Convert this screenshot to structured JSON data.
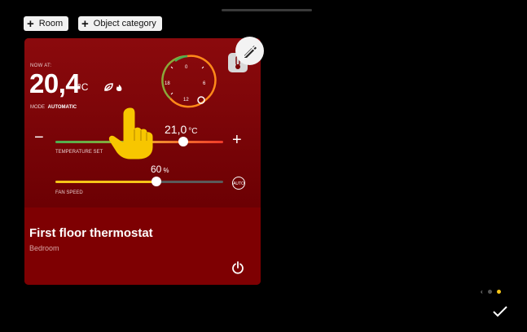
{
  "toolbar": {
    "room_label": "Room",
    "category_label": "Object category"
  },
  "card": {
    "now_at_label": "NOW AT:",
    "current_temp": "20,4",
    "temp_unit": "°C",
    "mode_label": "MODE",
    "mode_value": "AUTOMATIC",
    "dial_ticks": [
      "0",
      "6",
      "12",
      "18"
    ],
    "setpoint_value": "21,0",
    "setpoint_unit": "°C",
    "setpoint_level": 0.76,
    "temperature_setpoint_label": "TEMPERATURE SET",
    "fan_value": "60",
    "fan_unit": "%",
    "fan_level": 0.6,
    "fan_speed_label": "FAN SPEED",
    "auto_label": "AUTO",
    "title": "First floor thermostat",
    "subtitle": "Bedroom"
  },
  "icons": {
    "leaf": "leaf-icon",
    "flame": "flame-icon",
    "thermometer": "thermometer-icon",
    "power": "power-icon",
    "edit": "edit-badge-icon",
    "pointer": "hand-pointer-icon",
    "check": "check-icon"
  },
  "colors": {
    "card": "#7a0004",
    "accent_yellow": "#f5c518",
    "heat_red": "#f03a2a",
    "cool_green": "#4caf50",
    "dial_orange": "#ff8a1a"
  },
  "pager": {
    "pages": 2,
    "active": 2
  }
}
